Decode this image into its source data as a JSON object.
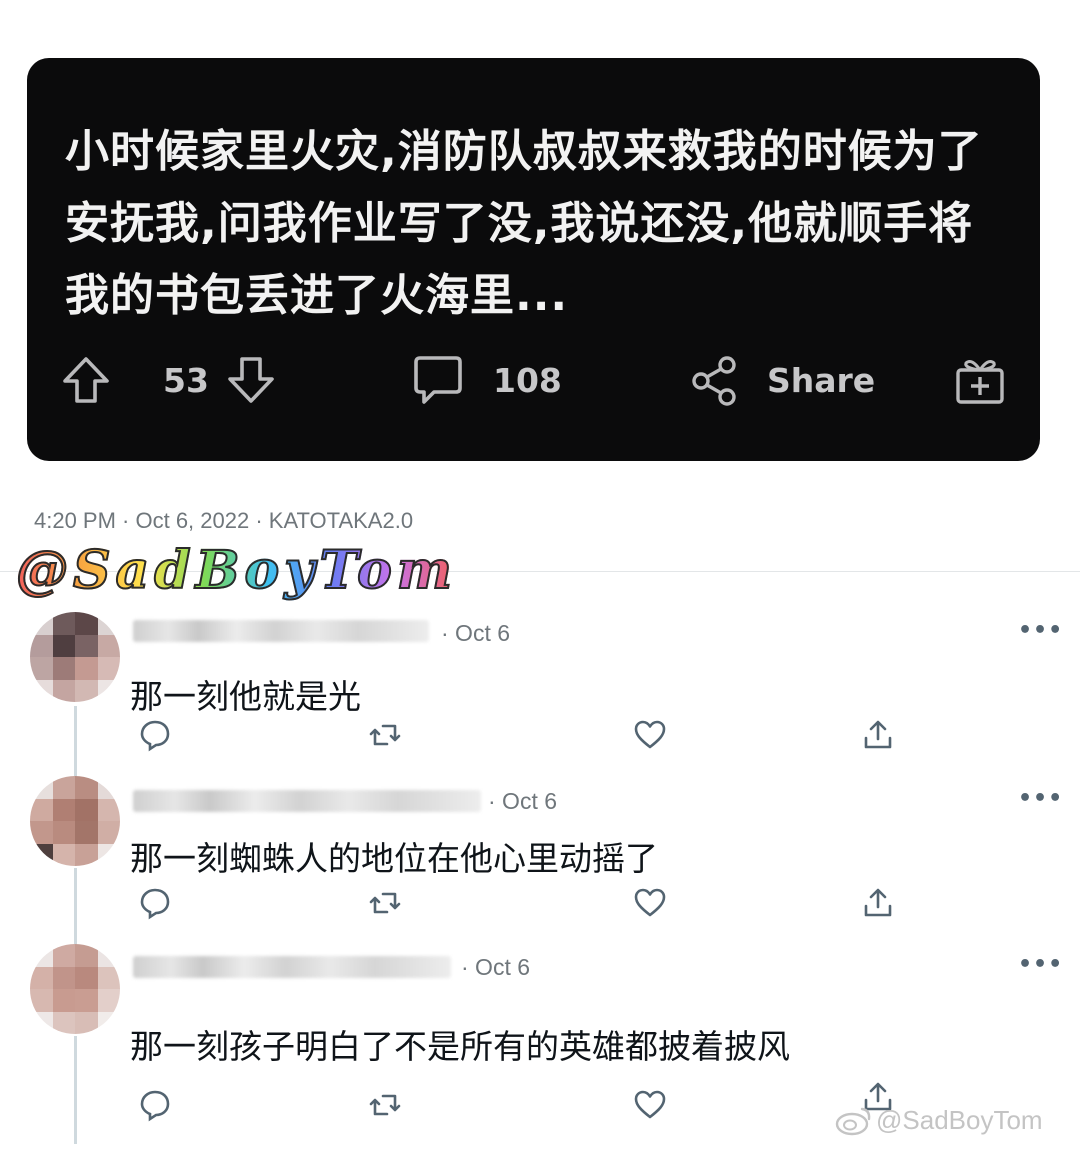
{
  "post": {
    "text": "小时候家里火灾,消防队叔叔来救我的时候为了安抚我,问我作业写了没,我说还没,他就顺手将我的书包丢进了火海里...",
    "upvotes": "53",
    "comments": "108",
    "share_label": "Share"
  },
  "meta": {
    "line": "4:20 PM · Oct 6, 2022 · KATOTAKA2.0",
    "handle_watermark": "@SadBoyTom"
  },
  "replies": [
    {
      "date": "· Oct 6",
      "text": "那一刻他就是光"
    },
    {
      "date": "· Oct 6",
      "text": "那一刻蜘蛛人的地位在他心里动摇了"
    },
    {
      "date": "· Oct 6",
      "text": "那一刻孩子明白了不是所有的英雄都披着披风"
    }
  ],
  "footer_watermark": "@SadBoyTom",
  "colors": {
    "card_bg": "#0b0b0c",
    "card_text": "#f2f2f2",
    "muted": "#6f767b"
  }
}
